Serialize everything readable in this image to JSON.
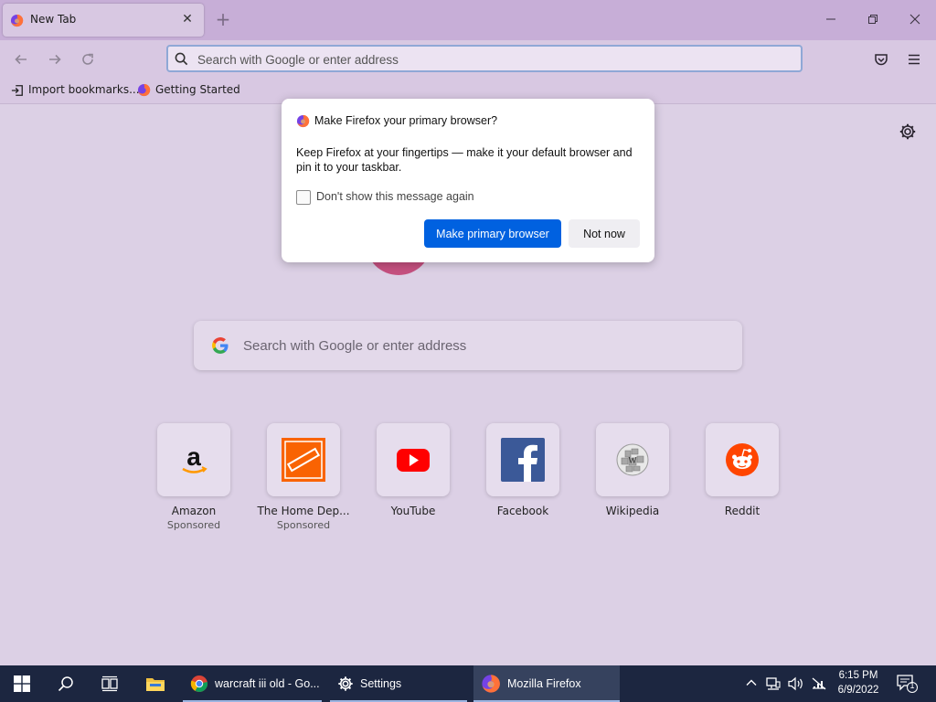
{
  "browser": {
    "tab": {
      "title": "New Tab"
    },
    "urlbar": {
      "placeholder": "Search with Google or enter address"
    },
    "bookmarks": [
      {
        "label": "Import bookmarks...",
        "icon": "import-icon"
      },
      {
        "label": "Getting Started",
        "icon": "firefox-icon"
      }
    ]
  },
  "newtab": {
    "search_placeholder": "Search with Google or enter address",
    "top_sites": [
      {
        "name": "Amazon",
        "sponsored": "Sponsored",
        "icon": "amazon-logo"
      },
      {
        "name": "The Home Dep...",
        "sponsored": "Sponsored",
        "icon": "home-depot-logo"
      },
      {
        "name": "YouTube",
        "icon": "youtube-logo"
      },
      {
        "name": "Facebook",
        "icon": "facebook-logo"
      },
      {
        "name": "Wikipedia",
        "icon": "wikipedia-logo"
      },
      {
        "name": "Reddit",
        "icon": "reddit-logo"
      }
    ]
  },
  "dialog": {
    "title": "Make Firefox your primary browser?",
    "message": "Keep Firefox at your fingertips — make it your default browser and pin it to your taskbar.",
    "checkbox_label": "Don't show this message again",
    "primary_button": "Make primary browser",
    "secondary_button": "Not now"
  },
  "taskbar": {
    "apps": [
      {
        "label": "warcraft iii old - Go...",
        "icon": "chrome-icon"
      },
      {
        "label": "Settings",
        "icon": "gear-icon"
      },
      {
        "label": "Mozilla Firefox",
        "icon": "firefox-icon",
        "active": true
      }
    ],
    "clock": {
      "time": "6:15 PM",
      "date": "6/9/2022"
    },
    "notification_count": "1"
  },
  "colors": {
    "accent": "#0061e0",
    "taskbar": "#1c2640",
    "chrome_purple": "#c7aed7"
  }
}
